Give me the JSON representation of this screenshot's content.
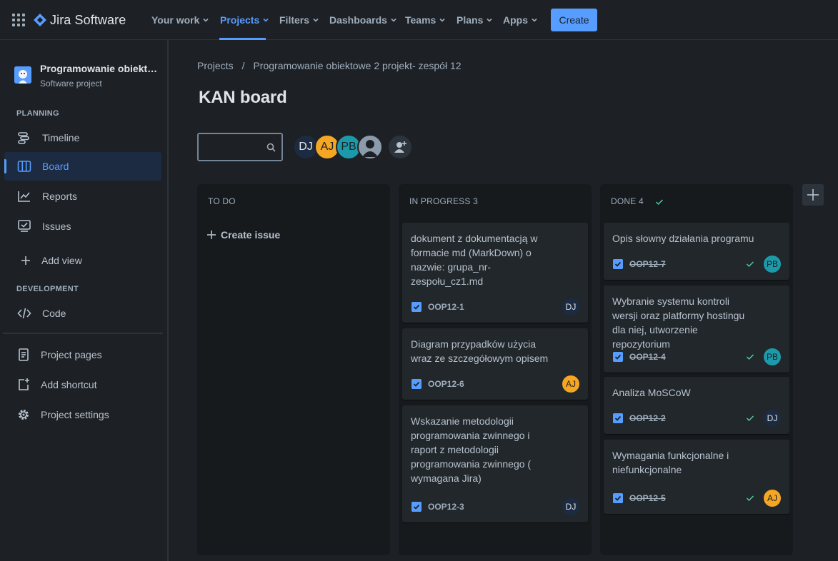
{
  "topnav": {
    "product": "Jira Software",
    "items": [
      {
        "label": "Your work"
      },
      {
        "label": "Projects"
      },
      {
        "label": "Filters"
      },
      {
        "label": "Dashboards"
      },
      {
        "label": "Teams"
      },
      {
        "label": "Plans"
      },
      {
        "label": "Apps"
      }
    ],
    "create_label": "Create"
  },
  "sidebar": {
    "project_name": "Programowanie obiektowe 2 projekt- zespół 12",
    "project_type": "Software project",
    "planning_label": "PLANNING",
    "development_label": "DEVELOPMENT",
    "items": {
      "timeline": "Timeline",
      "board": "Board",
      "reports": "Reports",
      "issues": "Issues",
      "add_view": "Add view",
      "code": "Code",
      "project_pages": "Project pages",
      "add_shortcut": "Add shortcut",
      "project_settings": "Project settings"
    }
  },
  "main": {
    "breadcrumb": [
      "Projects",
      "/",
      "Programowanie obiektowe 2 projekt- zespół 12"
    ],
    "title": "KAN board",
    "search_value": "",
    "avatars": [
      {
        "initials": "DJ",
        "color": "#1c2b41",
        "text": "#dee4ea"
      },
      {
        "initials": "AJ",
        "color": "#f5a623",
        "text": "#1d2125"
      },
      {
        "initials": "PB",
        "color": "#1d9aaa",
        "text": "#1d2125"
      },
      {
        "initials": "",
        "color": "#8c9bab",
        "text": "#1d2125"
      }
    ]
  },
  "board": {
    "todo": {
      "title": "TO DO",
      "create_label": "Create issue"
    },
    "in_progress": {
      "title": "IN PROGRESS 3",
      "cards": [
        {
          "text": "dokument z dokumentacją w formacie md (MarkDown) o nazwie: grupa_nr-zespołu_cz1.md",
          "key": "OOP12-1",
          "assignee": "DJ"
        },
        {
          "text": "Diagram przypadków użycia wraz ze szczegółowym opisem",
          "key": "OOP12-6",
          "assignee": "AJ"
        },
        {
          "text": "Wskazanie metodologii programowania zwinnego i raport z metodologii programowania zwinnego ( wymagana Jira)",
          "key": "OOP12-3",
          "assignee": "DJ"
        }
      ]
    },
    "done": {
      "title": "DONE 4",
      "cards": [
        {
          "text": "Opis słowny działania programu",
          "key": "OOP12-7",
          "assignee": "PB"
        },
        {
          "text": "Wybranie systemu kontroli wersji oraz platformy hostingu dla niej, utworzenie repozytorium",
          "key": "OOP12-4",
          "assignee": "PB"
        },
        {
          "text": "Analiza MoSCoW",
          "key": "OOP12-2",
          "assignee": "DJ"
        },
        {
          "text": "Wymagania funkcjonalne i niefunkcjonalne",
          "key": "OOP12-5",
          "assignee": "AJ"
        }
      ]
    }
  },
  "colors": {
    "accent": "#579dff",
    "done_check": "#4bce97",
    "dj": "#1c2b41",
    "aj": "#f5a623",
    "pb": "#1d9aaa"
  }
}
